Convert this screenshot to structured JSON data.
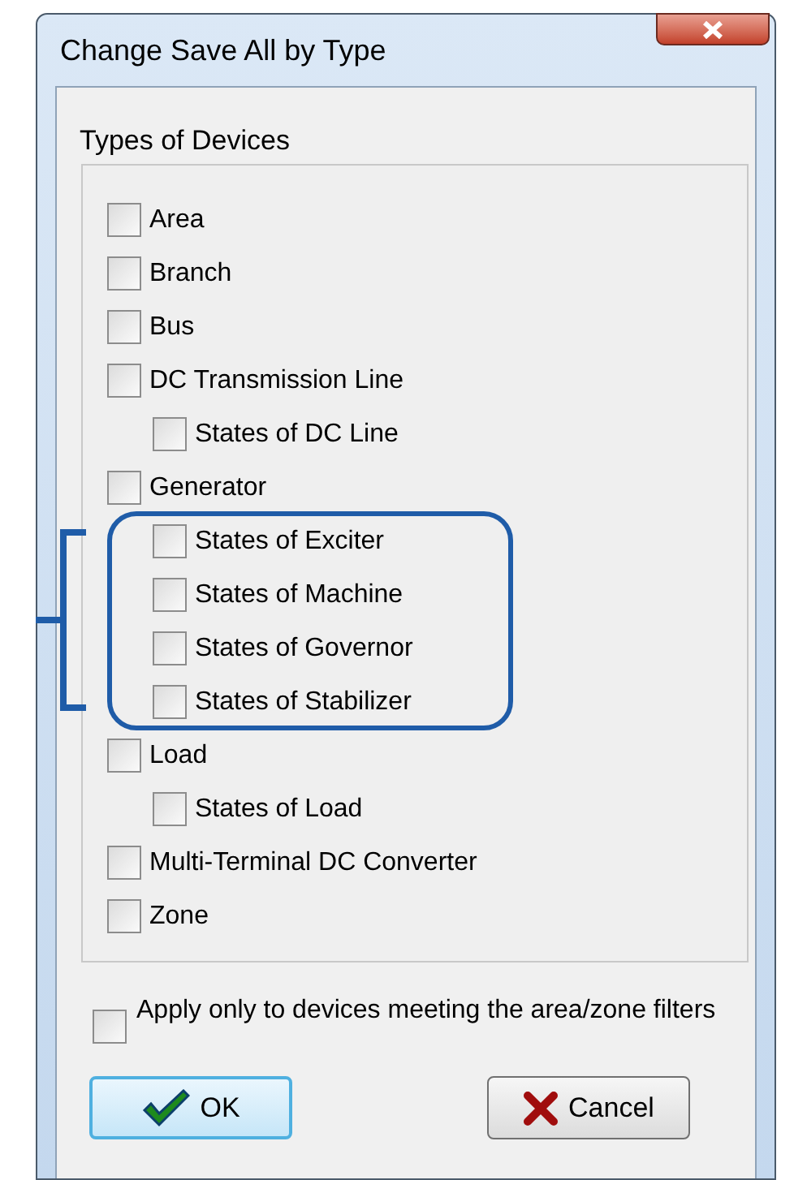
{
  "window": {
    "title": "Change Save All by Type"
  },
  "group": {
    "label": "Types of Devices"
  },
  "devices": [
    {
      "label": "Area",
      "checked": false
    },
    {
      "label": "Branch",
      "checked": false
    },
    {
      "label": "Bus",
      "checked": false
    },
    {
      "label": "DC Transmission Line",
      "checked": false,
      "children": [
        {
          "label": "States of DC Line",
          "checked": false,
          "highlighted": false
        }
      ]
    },
    {
      "label": "Generator",
      "checked": false,
      "children": [
        {
          "label": "States of Exciter",
          "checked": false,
          "highlighted": true
        },
        {
          "label": "States of Machine",
          "checked": false,
          "highlighted": true
        },
        {
          "label": "States of Governor",
          "checked": false,
          "highlighted": true
        },
        {
          "label": "States of Stabilizer",
          "checked": false,
          "highlighted": true
        }
      ]
    },
    {
      "label": "Load",
      "checked": false,
      "children": [
        {
          "label": "States of Load",
          "checked": false,
          "highlighted": false
        }
      ]
    },
    {
      "label": "Multi-Terminal DC Converter",
      "checked": false
    },
    {
      "label": "Zone",
      "checked": false
    }
  ],
  "filter_option": {
    "label": "Apply only to devices meeting the area/zone filters",
    "checked": false
  },
  "buttons": [
    {
      "kind": "ok",
      "label": "OK",
      "focused": true
    },
    {
      "kind": "cancel",
      "label": "Cancel",
      "focused": false
    }
  ]
}
